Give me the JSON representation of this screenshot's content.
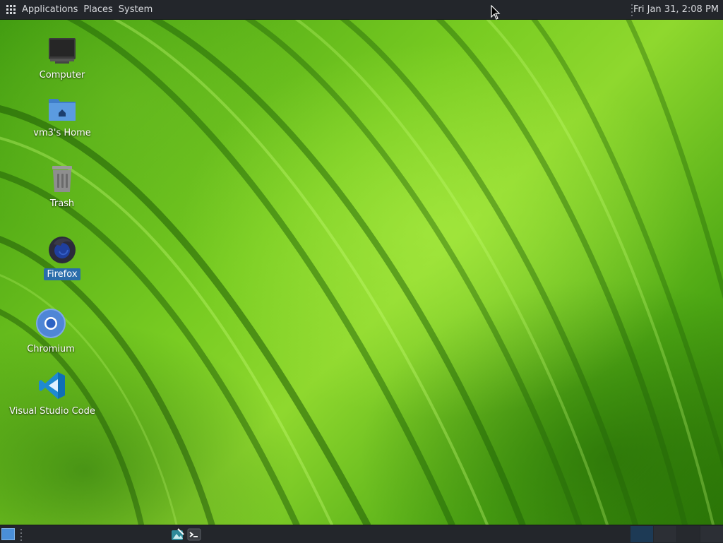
{
  "top_panel": {
    "menus": [
      "Applications",
      "Places",
      "System"
    ],
    "clock": "Fri Jan 31,  2:08 PM"
  },
  "desktop": {
    "icons": [
      {
        "label": "Computer",
        "icon": "computer-icon"
      },
      {
        "label": "vm3's Home",
        "icon": "home-folder-icon"
      },
      {
        "label": "Trash",
        "icon": "trash-icon"
      },
      {
        "label": "Firefox",
        "icon": "firefox-icon",
        "selected": true
      },
      {
        "label": "Chromium",
        "icon": "chromium-icon"
      },
      {
        "label": "Visual Studio Code",
        "icon": "vscode-icon"
      }
    ]
  },
  "bottom_panel": {
    "launchers": [
      "image-editor-icon",
      "terminal-icon"
    ],
    "workspaces": 4
  },
  "colors": {
    "panel": "#23262b",
    "selection": "#2a6dab",
    "wallpaper_green": "#79cc22"
  }
}
